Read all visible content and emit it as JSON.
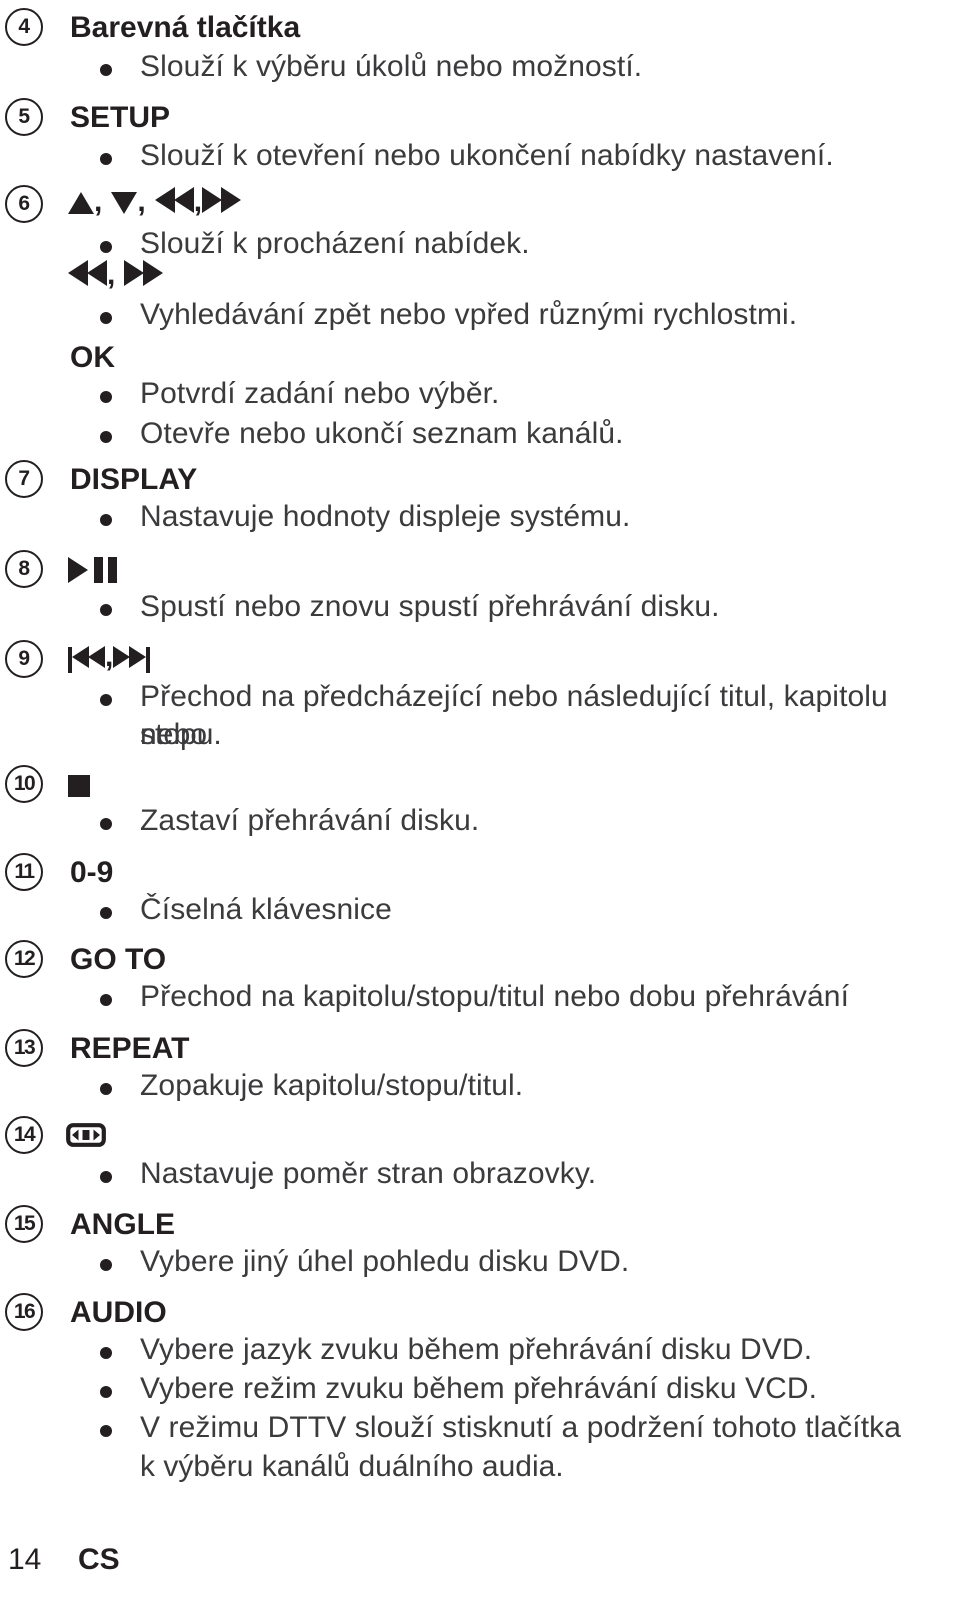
{
  "page": {
    "footer_page_number": "14",
    "footer_language_code": "CS",
    "text_color": "#3b3b3d",
    "heading_color": "#231f20",
    "background": "#ffffff"
  },
  "entries": [
    {
      "number": "4",
      "label": "Barevná tlačítka",
      "symbols": [],
      "bullets": [
        {
          "text": "Slouží k výběru úkolů nebo možností."
        }
      ]
    },
    {
      "number": "5",
      "label": "SETUP",
      "symbols": [],
      "bullets": [
        {
          "text": "Slouží k otevření nebo ukončení nabídky nastavení."
        }
      ]
    },
    {
      "number": "6",
      "label": "",
      "symbols": [
        "up-arrow-icon",
        "down-arrow-icon",
        "rewind-icon",
        "fast-forward-icon"
      ],
      "bullets": [
        {
          "text": "Slouží k procházení nabídek."
        }
      ],
      "sub_groups": [
        {
          "symbols": [
            "rewind-icon",
            "fast-forward-icon"
          ],
          "bullets": [
            {
              "text": "Vyhledávání zpět nebo vpřed různými rychlostmi."
            }
          ]
        },
        {
          "label": "OK",
          "bullets": [
            {
              "text": "Potvrdí zadání nebo výběr."
            },
            {
              "text": "Otevře nebo ukončí seznam kanálů."
            }
          ]
        }
      ]
    },
    {
      "number": "7",
      "label": "DISPLAY",
      "symbols": [],
      "bullets": [
        {
          "text": "Nastavuje hodnoty displeje systému."
        }
      ]
    },
    {
      "number": "8",
      "label": "",
      "symbols": [
        "play-pause-icon"
      ],
      "bullets": [
        {
          "text": "Spustí nebo znovu spustí přehrávání disku."
        }
      ]
    },
    {
      "number": "9",
      "label": "",
      "symbols": [
        "previous-track-icon",
        "next-track-icon"
      ],
      "bullets": [
        {
          "text": "Přechod na předcházející nebo následující titul, kapitolu nebo",
          "continuation": "stopu."
        }
      ]
    },
    {
      "number": "10",
      "label": "",
      "symbols": [
        "stop-icon"
      ],
      "bullets": [
        {
          "text": "Zastaví přehrávání disku."
        }
      ]
    },
    {
      "number": "11",
      "label": "0-9",
      "symbols": [],
      "bullets": [
        {
          "text": "Číselná klávesnice"
        }
      ]
    },
    {
      "number": "12",
      "label": "GO TO",
      "symbols": [],
      "bullets": [
        {
          "text": "Přechod na kapitolu/stopu/titul nebo dobu přehrávání"
        }
      ]
    },
    {
      "number": "13",
      "label": "REPEAT",
      "symbols": [],
      "bullets": [
        {
          "text": "Zopakuje kapitolu/stopu/titul."
        }
      ]
    },
    {
      "number": "14",
      "label": "",
      "symbols": [
        "aspect-ratio-icon"
      ],
      "bullets": [
        {
          "text": "Nastavuje poměr stran obrazovky."
        }
      ]
    },
    {
      "number": "15",
      "label": "ANGLE",
      "symbols": [],
      "bullets": [
        {
          "text": "Vybere jiný úhel pohledu disku DVD."
        }
      ]
    },
    {
      "number": "16",
      "label": "AUDIO",
      "symbols": [],
      "bullets": [
        {
          "text": "Vybere jazyk zvuku během přehrávání disku DVD."
        },
        {
          "text": "Vybere režim zvuku během přehrávání disku VCD."
        },
        {
          "text": "V režimu DTTV slouží stisknutí a podržení tohoto tlačítka",
          "continuation": "k výběru kanálů duálního audia."
        }
      ]
    }
  ]
}
